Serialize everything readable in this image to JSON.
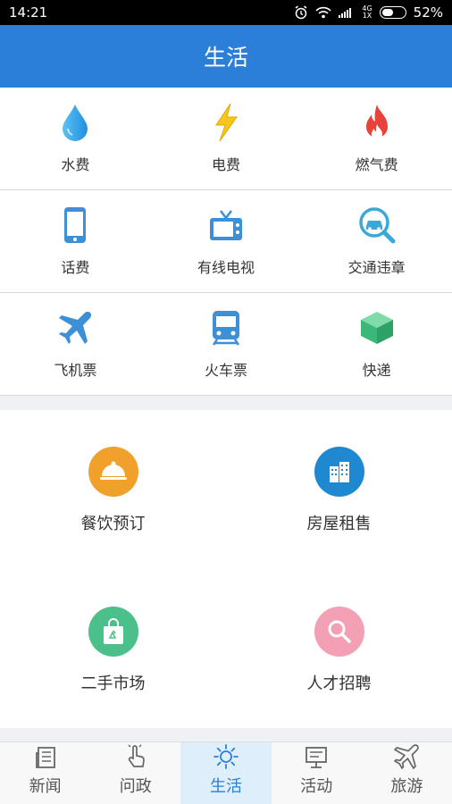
{
  "status": {
    "time": "14:21",
    "network": "4G",
    "network_sub": "1X",
    "battery": "52%",
    "battery_level": 0.52
  },
  "header": {
    "title": "生活"
  },
  "grid": [
    [
      {
        "label": "水费",
        "icon": "water-drop-icon"
      },
      {
        "label": "电费",
        "icon": "lightning-icon"
      },
      {
        "label": "燃气费",
        "icon": "flame-icon"
      }
    ],
    [
      {
        "label": "话费",
        "icon": "phone-icon"
      },
      {
        "label": "有线电视",
        "icon": "tv-icon"
      },
      {
        "label": "交通违章",
        "icon": "car-search-icon"
      }
    ],
    [
      {
        "label": "飞机票",
        "icon": "plane-icon"
      },
      {
        "label": "火车票",
        "icon": "train-icon"
      },
      {
        "label": "快递",
        "icon": "box-icon"
      }
    ]
  ],
  "services": [
    {
      "label": "餐饮预订",
      "icon": "dish-icon",
      "color": "#f0a12c"
    },
    {
      "label": "房屋租售",
      "icon": "building-icon",
      "color": "#1e88d0"
    },
    {
      "label": "二手市场",
      "icon": "recycle-bag-icon",
      "color": "#4cc08a"
    },
    {
      "label": "人才招聘",
      "icon": "search-icon",
      "color": "#f4a0b4"
    }
  ],
  "tabs": [
    {
      "label": "新闻",
      "icon": "news-icon",
      "active": false
    },
    {
      "label": "问政",
      "icon": "hand-tap-icon",
      "active": false
    },
    {
      "label": "生活",
      "icon": "sun-icon",
      "active": true
    },
    {
      "label": "活动",
      "icon": "board-icon",
      "active": false
    },
    {
      "label": "旅游",
      "icon": "plane-outline-icon",
      "active": false
    }
  ],
  "colors": {
    "primary": "#2b7fd8",
    "active_tab_bg": "#dfeefb"
  }
}
